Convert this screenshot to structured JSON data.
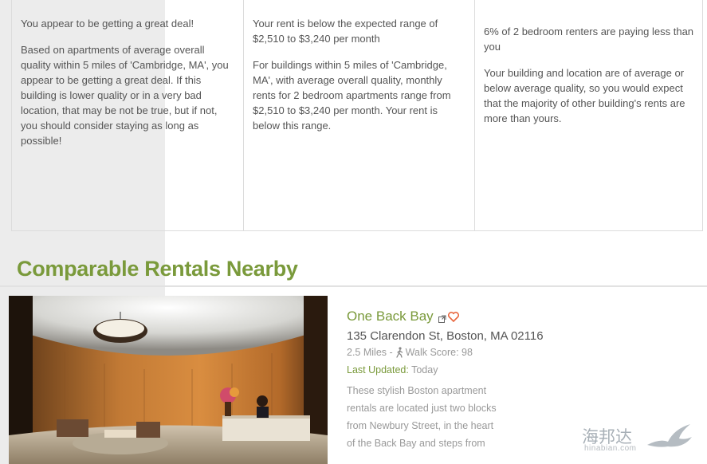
{
  "analysis": {
    "deal": {
      "heading": "You appear to be getting a great deal!",
      "body": "Based on apartments of average overall quality within 5 miles of 'Cambridge, MA', you appear to be getting a great deal. If this building is lower quality or in a very bad location, that may be not be true, but if not, you should consider staying as long as possible!"
    },
    "range": {
      "heading": "Your rent is below the expected range of $2,510 to $3,240 per month",
      "body": "For buildings within 5 miles of 'Cambridge, MA', with average overall quality, monthly rents for 2 bedroom apartments range from $2,510 to $3,240 per month. Your rent is below this range."
    },
    "percentile": {
      "heading": "6% of 2 bedroom renters are paying less than you",
      "body": "Your building and location are of average or below average quality, so you would expect that the majority of other building's rents are more than yours."
    }
  },
  "comparables": {
    "title": "Comparable Rentals Nearby",
    "listings": [
      {
        "name": "One Back Bay",
        "address": "135 Clarendon St, Boston, MA 02116",
        "distance": "2.5 Miles -",
        "walk_score": "Walk Score: 98",
        "updated_label": "Last Updated:",
        "updated_value": "Today",
        "description": "These stylish Boston apartment rentals are located just two blocks from Newbury Street, in the heart of the Back Bay and steps from",
        "icons": [
          "external-link-icon",
          "heart-icon",
          "walk-icon"
        ]
      }
    ]
  },
  "watermark": {
    "cn": "海邦达",
    "en": "hinabian.com"
  },
  "colors": {
    "accent_green": "#7a9a3b",
    "heart": "#e8663d",
    "muted_text": "#999999",
    "body_text": "#555555"
  }
}
